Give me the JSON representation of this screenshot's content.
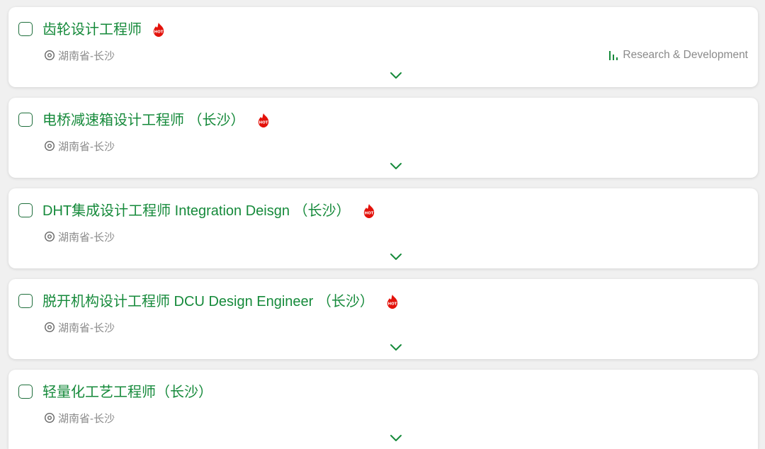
{
  "colors": {
    "title_green": "#168a3b",
    "checkbox_border": "#1f6f3c",
    "hot_red": "#e3120b",
    "meta_gray": "#8a8a8a"
  },
  "icons": {
    "location": "location-pin-icon",
    "hot": "hot-flame-badge-icon",
    "department": "bar-chart-icon",
    "expand": "chevron-down-icon"
  },
  "jobs": [
    {
      "title": "齿轮设计工程师",
      "hot": true,
      "location": "湖南省-长沙",
      "department": "Research & Development"
    },
    {
      "title": "电桥减速箱设计工程师 （长沙）",
      "hot": true,
      "location": "湖南省-长沙",
      "department": ""
    },
    {
      "title": "DHT集成设计工程师 Integration Deisgn （长沙）",
      "hot": true,
      "location": "湖南省-长沙",
      "department": ""
    },
    {
      "title": "脱开机构设计工程师 DCU Design Engineer （长沙）",
      "hot": true,
      "location": "湖南省-长沙",
      "department": ""
    },
    {
      "title": "轻量化工艺工程师（长沙）",
      "hot": false,
      "location": "湖南省-长沙",
      "department": ""
    }
  ]
}
